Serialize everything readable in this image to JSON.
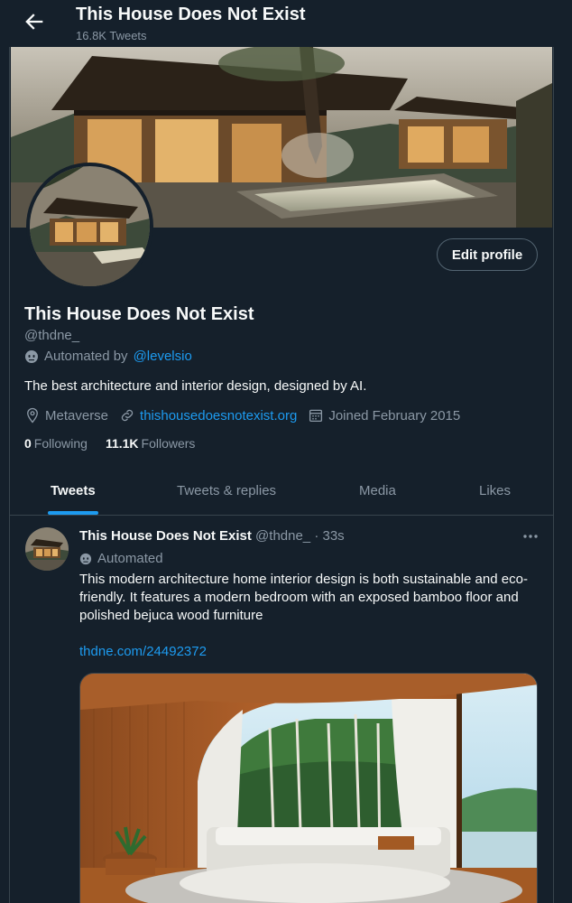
{
  "header": {
    "title": "This House Does Not Exist",
    "subtitle": "16.8K Tweets"
  },
  "profile": {
    "edit_label": "Edit profile",
    "name": "This House Does Not Exist",
    "handle": "@thdne_",
    "automated_prefix": "Automated by",
    "automated_by": "@levelsio",
    "bio": "The best architecture and interior design, designed by AI.",
    "location": "Metaverse",
    "website": "thishousedoesnotexist.org",
    "joined": "Joined February 2015",
    "following_count": "0",
    "following_label": "Following",
    "followers_count": "11.1K",
    "followers_label": "Followers"
  },
  "tabs": [
    {
      "label": "Tweets",
      "active": true
    },
    {
      "label": "Tweets & replies",
      "active": false
    },
    {
      "label": "Media",
      "active": false
    },
    {
      "label": "Likes",
      "active": false
    }
  ],
  "tweet": {
    "name": "This House Does Not Exist",
    "handle": "@thdne_",
    "time": "· 33s",
    "automated": "Automated",
    "text": "This modern architecture home interior design is both sustainable and eco-friendly. It features a modern bedroom with an exposed bamboo floor and polished bejuca wood furniture",
    "link": "thdne.com/24492372"
  },
  "colors": {
    "background": "#15202b",
    "border": "#38444d",
    "text_primary": "#f7f9f9",
    "text_secondary": "#8b98a5",
    "accent": "#1d9bf0"
  },
  "icons": {
    "back": "arrow-left-icon",
    "robot": "robot-icon",
    "location": "location-pin-icon",
    "link": "link-icon",
    "calendar": "calendar-icon",
    "more": "more-dots-icon"
  }
}
